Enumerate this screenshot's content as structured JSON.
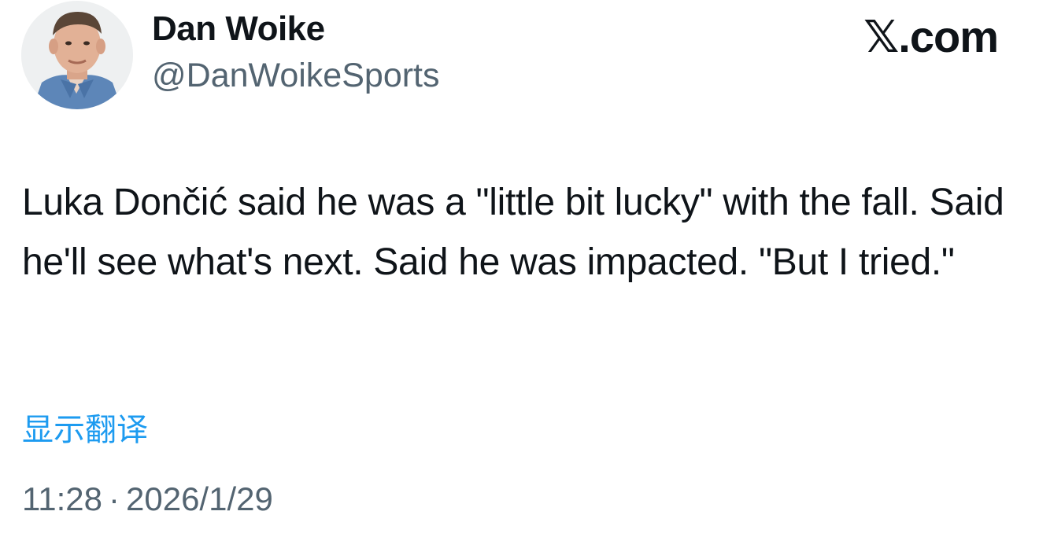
{
  "author": {
    "display_name": "Dan Woike",
    "handle": "@DanWoikeSports",
    "avatar": "avatar-photo"
  },
  "brand": {
    "label": "𝕏.com"
  },
  "tweet": {
    "text": "Luka Dončić said he was a \"little bit lucky\" with the fall. Said he'll see what's next. Said he was impacted. \"But I tried.\"",
    "translate_label": "显示翻译"
  },
  "meta": {
    "time": "11:28",
    "separator": "·",
    "date": "2026/1/29"
  },
  "colors": {
    "text": "#0f1419",
    "secondary": "#536471",
    "link": "#1d9bf0",
    "background": "#ffffff"
  }
}
